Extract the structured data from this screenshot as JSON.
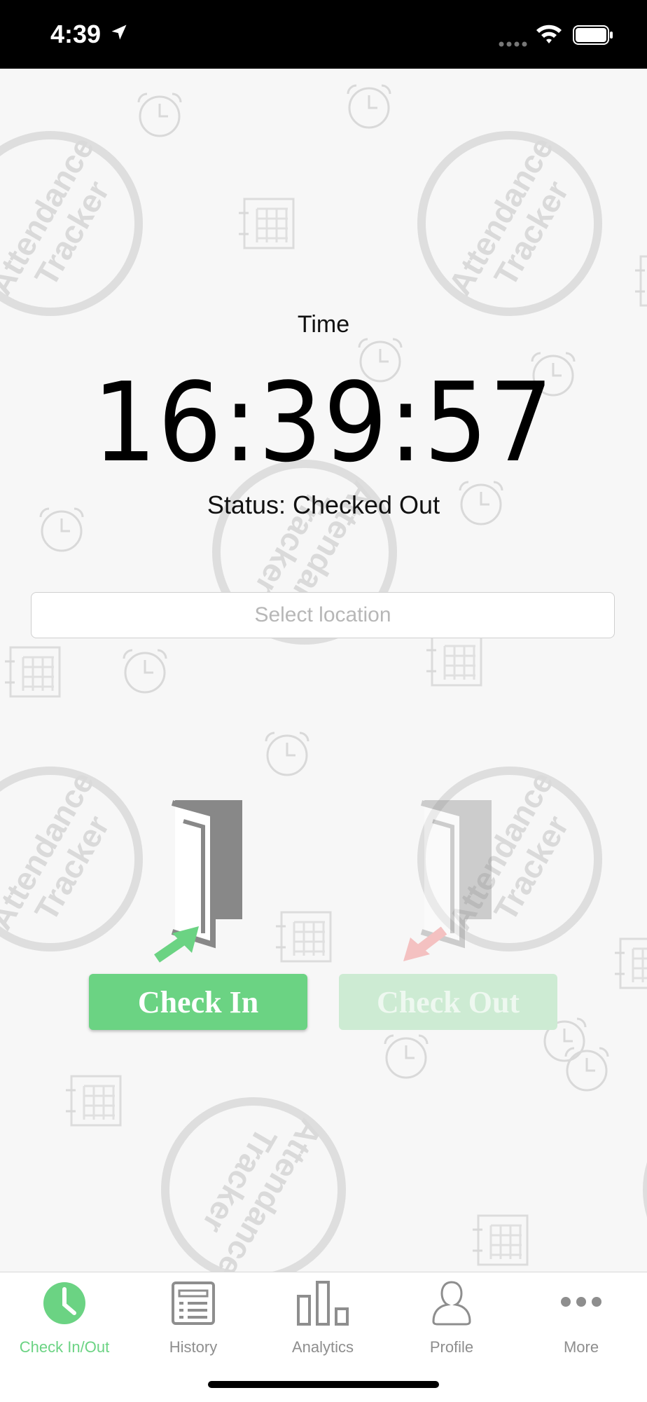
{
  "status_bar": {
    "time": "4:39",
    "icons": [
      "location-arrow-icon",
      "signal-dots-icon",
      "wifi-icon",
      "battery-icon"
    ]
  },
  "background": {
    "watermark_line1": "Attendance",
    "watermark_line2": "Tracker"
  },
  "main": {
    "time_label": "Time",
    "clock_value": "16:39:57",
    "status_text": "Status: Checked Out",
    "location_placeholder": "Select location"
  },
  "actions": {
    "check_in_label": "Check In",
    "check_out_label": "Check Out",
    "check_in_enabled": true,
    "check_out_enabled": false
  },
  "tab_bar": {
    "items": [
      {
        "label": "Check In/Out",
        "icon": "clock-icon",
        "active": true
      },
      {
        "label": "History",
        "icon": "list-icon",
        "active": false
      },
      {
        "label": "Analytics",
        "icon": "bar-chart-icon",
        "active": false
      },
      {
        "label": "Profile",
        "icon": "person-icon",
        "active": false
      },
      {
        "label": "More",
        "icon": "ellipsis-icon",
        "active": false
      }
    ]
  },
  "colors": {
    "accent_green": "#6bd383",
    "disabled_green": "#cdebd3",
    "disabled_red_arrow": "#f6b7b7",
    "tab_inactive": "#8e8e8e"
  }
}
